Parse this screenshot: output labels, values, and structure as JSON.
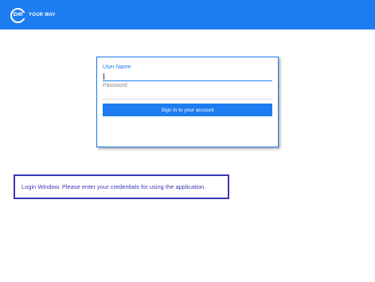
{
  "header": {
    "logo_badge": "EHR",
    "logo_text": "YOUR WAY",
    "background_color": "#1c7cf0"
  },
  "login": {
    "username_label": "User Name",
    "username_value": "",
    "password_label": "Password",
    "password_value": "",
    "signin_label": "Sign in to your account",
    "accent_color": "#1c7cf0"
  },
  "info": {
    "message": "Login Window. Please enter your credentials for using the application.",
    "color": "#3b37b5"
  }
}
